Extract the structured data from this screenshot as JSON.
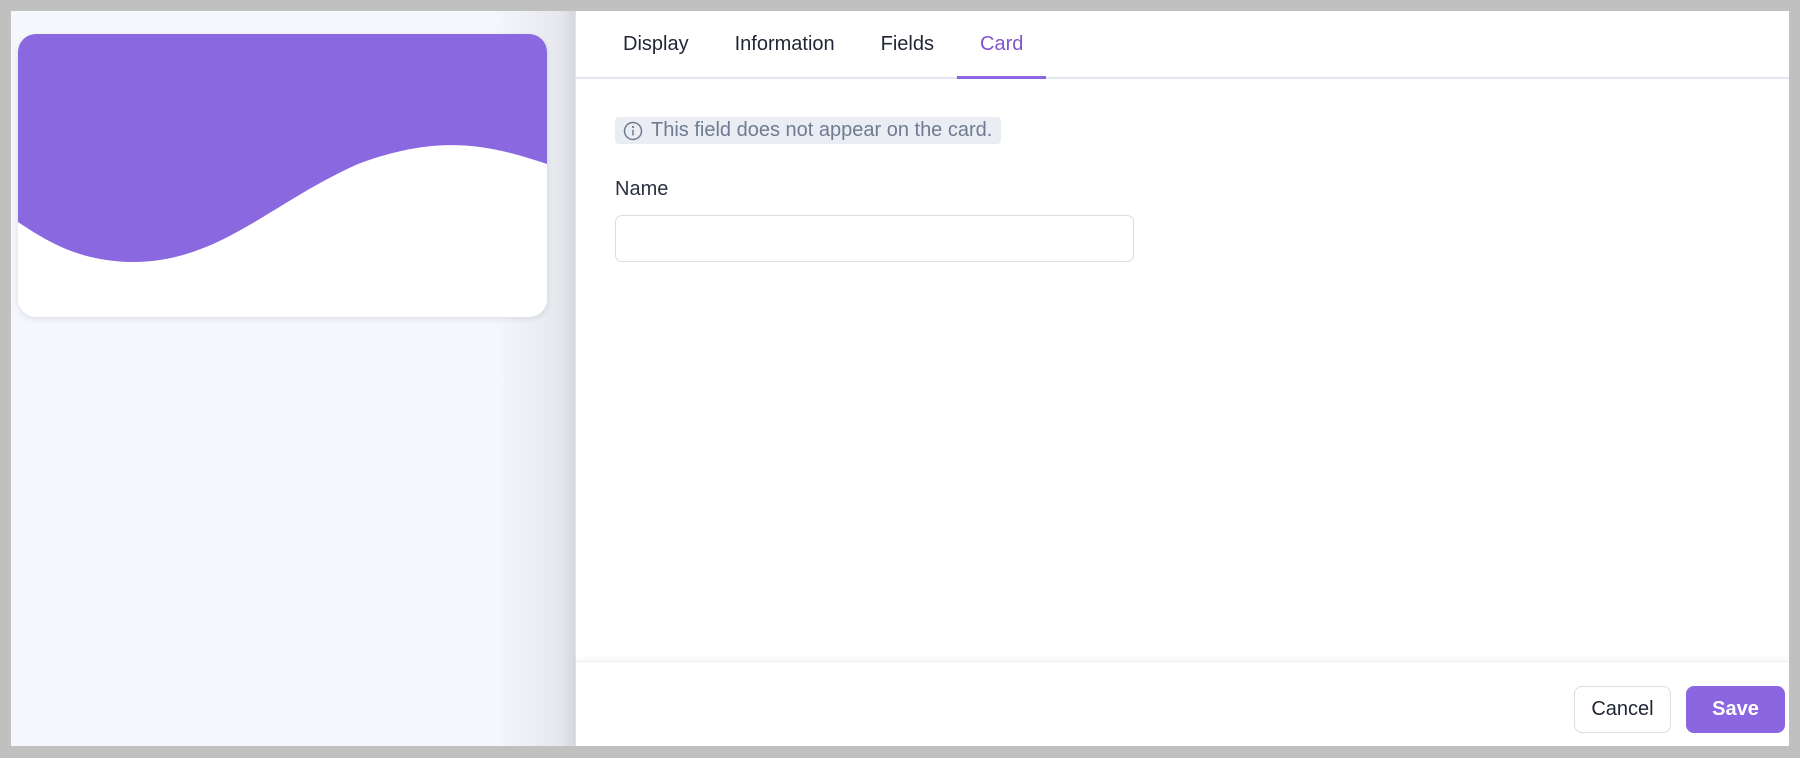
{
  "colors": {
    "accent": "#8b66e0",
    "accent_text": "#7e55cc",
    "card_wave": "#8a68e0"
  },
  "tabs": [
    {
      "label": "Display",
      "active": false
    },
    {
      "label": "Information",
      "active": false
    },
    {
      "label": "Fields",
      "active": false
    },
    {
      "label": "Card",
      "active": true
    }
  ],
  "notice": {
    "icon": "info-circle-icon",
    "text": "This field does not appear on the card."
  },
  "name_field": {
    "label": "Name",
    "value": "",
    "placeholder": ""
  },
  "footer": {
    "cancel_label": "Cancel",
    "save_label": "Save"
  }
}
